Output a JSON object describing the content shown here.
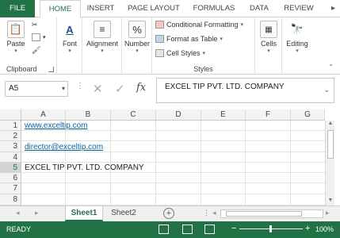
{
  "tabs": {
    "file": "FILE",
    "home": "HOME",
    "insert": "INSERT",
    "page_layout": "PAGE LAYOUT",
    "formulas": "FORMULAS",
    "data": "DATA",
    "review": "REVIEW"
  },
  "ribbon": {
    "clipboard": {
      "label": "Clipboard",
      "paste": "Paste"
    },
    "font": {
      "label": "Font"
    },
    "alignment": {
      "label": "Alignment"
    },
    "number": {
      "label": "Number",
      "icon_text": "%"
    },
    "styles": {
      "label": "Styles",
      "conditional": "Conditional Formatting",
      "format_table": "Format as Table",
      "cell_styles": "Cell Styles"
    },
    "cells": {
      "label": "Cells"
    },
    "editing": {
      "label": "Editing"
    }
  },
  "formula_bar": {
    "name_box": "A5",
    "fx": "fx",
    "content": "EXCEL TIP PVT. LTD. COMPANY"
  },
  "grid": {
    "columns": [
      "A",
      "B",
      "C",
      "D",
      "E",
      "F",
      "G"
    ],
    "rows": [
      "1",
      "2",
      "3",
      "4",
      "5",
      "6",
      "7",
      "8"
    ],
    "cells": {
      "A1": "www.exceltip.com",
      "A3": "director@exceltip.com",
      "A5": "EXCEL TIP PVT. LTD. COMPANY"
    }
  },
  "sheets": [
    "Sheet1",
    "Sheet2"
  ],
  "status": {
    "ready": "READY",
    "zoom": "100%"
  },
  "colors": {
    "accent": "#217346",
    "link": "#0563c1"
  }
}
